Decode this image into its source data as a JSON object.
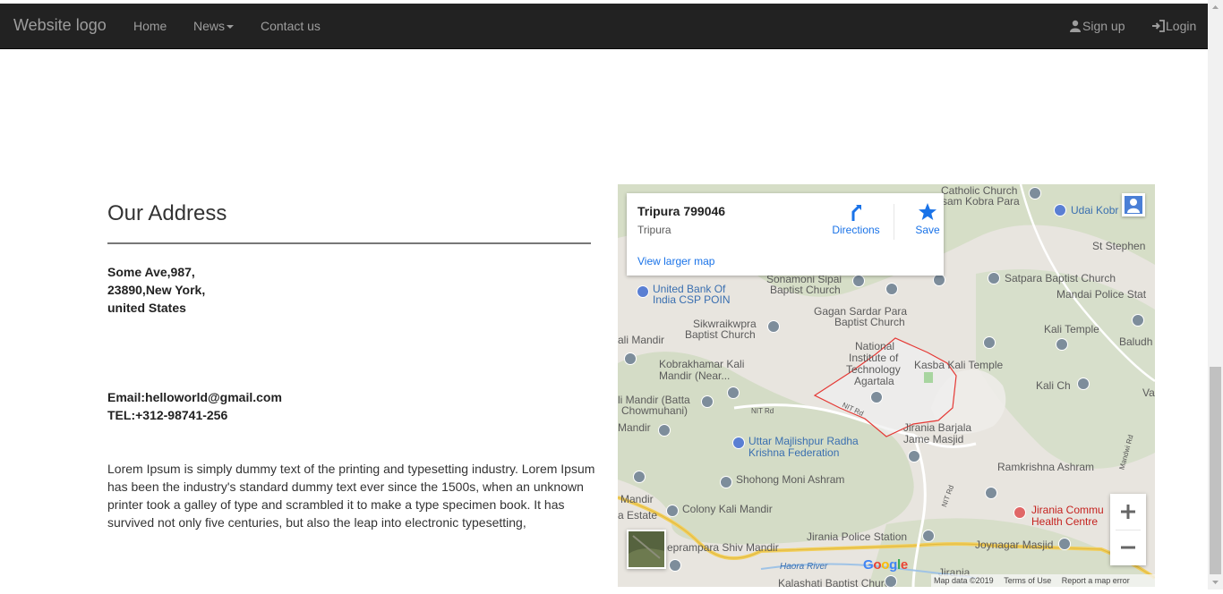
{
  "navbar": {
    "brand": "Website logo",
    "links": [
      {
        "label": "Home"
      },
      {
        "label": "News"
      },
      {
        "label": "Contact us"
      }
    ],
    "signup": "Sign up",
    "login": "Login",
    "bg_color": "#222222",
    "text_color": "#9d9d9d"
  },
  "address_section": {
    "title": "Our Address",
    "address_lines": [
      "Some Ave,987,",
      "23890,New York,",
      "united States"
    ],
    "email": "Email:helloworld@gmail.com",
    "phone": "TEL:+312-98741-256",
    "description": "Lorem Ipsum is simply dummy text of the printing and typesetting industry. Lorem Ipsum has been the industry's standard dummy text ever since the 1500s, when an unknown printer took a galley of type and scrambled it to make a type specimen book. It has survived not only five centuries, but also the leap into electronic typesetting,"
  },
  "map": {
    "info_card": {
      "title": "Tripura 799046",
      "subtitle": "Tripura",
      "directions": "Directions",
      "save": "Save",
      "view_larger": "View larger map"
    },
    "labels": [
      "Catholic Church",
      "sam Kobra Para",
      "Udai Kobr",
      "St Stephen",
      "Sonamoni Sipai",
      "Baptist Church",
      "United Bank Of",
      "India CSP POIN",
      "Satpara Baptist Church",
      "Mandai Police Stat",
      "Gagan Sardar Para",
      "Baptist Church",
      "Sikwraikwpra",
      "Baptist Church",
      "ali Mandir",
      "Kali Temple",
      "Baludh",
      "National",
      "Institute of",
      "Technology",
      "Agartala",
      "Kasba Kali Temple",
      "Kobrakhamar Kali",
      "Mandir (Near...",
      "Kali Ch",
      "Va",
      "li Mandir (Batta",
      "Chowmuhani)",
      "Jirania Barjala",
      "Jame Masjid",
      "Mandir",
      "Uttar Majlishpur Radha",
      "Krishna Federation",
      "Ramkrishna Ashram",
      "Shohong Moni Ashram",
      "Mandir",
      "Colony Kali Mandir",
      "a Estate",
      "Jirania Commu",
      "Health Centre",
      "Jirania Police Station",
      "Joynagar Masjid",
      "eprampara Shiv Mandir",
      "Jirania",
      "Kalashati Baptist Church"
    ],
    "road_labels": [
      "NIT Rd",
      "NIT Rd",
      "NIT Rd",
      "Mandwi Rd",
      "Haora River"
    ],
    "google": "Google",
    "footer": {
      "data": "Map data ©2019",
      "terms": "Terms of Use",
      "report": "Report a map error"
    },
    "zoom_in": "+",
    "zoom_out": "−"
  }
}
